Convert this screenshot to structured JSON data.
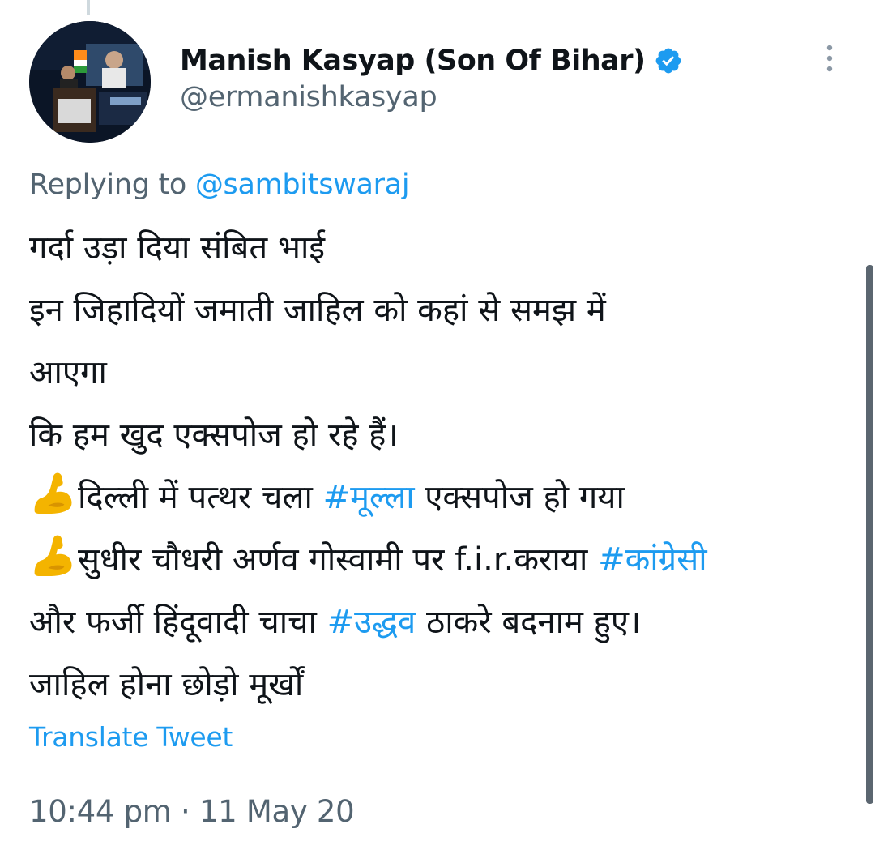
{
  "author": {
    "display_name": "Manish Kasyap (Son Of Bihar)",
    "handle": "@ermanishkasyap",
    "verified": true,
    "avatar_icon": "profile-photo-speaker-at-podium"
  },
  "reply": {
    "prefix": "Replying to ",
    "mention": "@sambitswaraj"
  },
  "tweet": {
    "lines": [
      {
        "text": "गर्दा उड़ा दिया संबित भाई"
      },
      {
        "text": "इन जिहादियों जमाती जाहिल  को कहां से समझ में"
      },
      {
        "text": "आएगा"
      },
      {
        "text": "कि हम खुद एक्सपोज हो रहे हैं।"
      },
      {
        "emoji": "flexed-biceps-emoji",
        "before": "दिल्ली में पत्थर चला ",
        "hashtag": "#मूल्ला",
        "after": " एक्सपोज हो गया"
      },
      {
        "emoji": "flexed-biceps-emoji",
        "before": "सुधीर चौधरी अर्णव गोस्वामी पर f.i.r.कराया ",
        "hashtag": "#कांग्रेसी",
        "after": ""
      },
      {
        "before": "और फर्जी हिंदूवादी चाचा ",
        "hashtag": "#उद्धव",
        "after": " ठाकरे बदनाम हुए।"
      },
      {
        "text": "जाहिल होना छोड़ो मूर्खों"
      }
    ]
  },
  "translate_label": "Translate Tweet",
  "timestamp": "10:44 pm · 11 May 20",
  "colors": {
    "link": "#1d9bf0",
    "secondary_text": "#536471",
    "primary_text": "#0f1419",
    "verified_badge": "#1d9bf0"
  }
}
